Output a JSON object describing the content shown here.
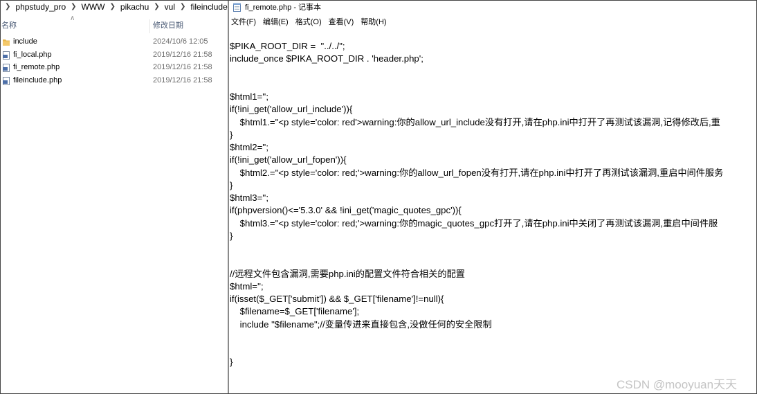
{
  "explorer": {
    "breadcrumb": [
      "phpstudy_pro",
      "WWW",
      "pikachu",
      "vul",
      "fileinclude"
    ],
    "columns": {
      "name": "名称",
      "date_modified": "修改日期"
    },
    "files": [
      {
        "name": "include",
        "date": "2024/10/6 12:05",
        "icon": "folder-icon"
      },
      {
        "name": "fi_local.php",
        "date": "2019/12/16 21:58",
        "icon": "php-file-icon"
      },
      {
        "name": "fi_remote.php",
        "date": "2019/12/16 21:58",
        "icon": "php-file-icon"
      },
      {
        "name": "fileinclude.php",
        "date": "2019/12/16 21:58",
        "icon": "php-file-icon"
      }
    ]
  },
  "notepad": {
    "title": "fi_remote.php - 记事本",
    "menu": [
      "文件(F)",
      "编辑(E)",
      "格式(O)",
      "查看(V)",
      "帮助(H)"
    ],
    "lines": [
      "$PIKA_ROOT_DIR =  \"../../\";",
      "include_once $PIKA_ROOT_DIR . 'header.php';",
      "",
      "",
      "$html1='';",
      "if(!ini_get('allow_url_include')){",
      "    $html1.=\"<p style='color: red'>warning:你的allow_url_include没有打开,请在php.ini中打开了再测试该漏洞,记得修改后,重",
      "}",
      "$html2='';",
      "if(!ini_get('allow_url_fopen')){",
      "    $html2.=\"<p style='color: red;'>warning:你的allow_url_fopen没有打开,请在php.ini中打开了再测试该漏洞,重启中间件服务",
      "}",
      "$html3='';",
      "if(phpversion()<='5.3.0' && !ini_get('magic_quotes_gpc')){",
      "    $html3.=\"<p style='color: red;'>warning:你的magic_quotes_gpc打开了,请在php.ini中关闭了再测试该漏洞,重启中间件服",
      "}",
      "",
      "",
      "//远程文件包含漏洞,需要php.ini的配置文件符合相关的配置",
      "$html='';",
      "if(isset($_GET['submit']) && $_GET['filename']!=null){",
      "    $filename=$_GET['filename'];",
      "    include \"$filename\";//变量传进来直接包含,没做任何的安全限制",
      "",
      "",
      "}"
    ]
  },
  "watermark": "CSDN @mooyuan天天"
}
